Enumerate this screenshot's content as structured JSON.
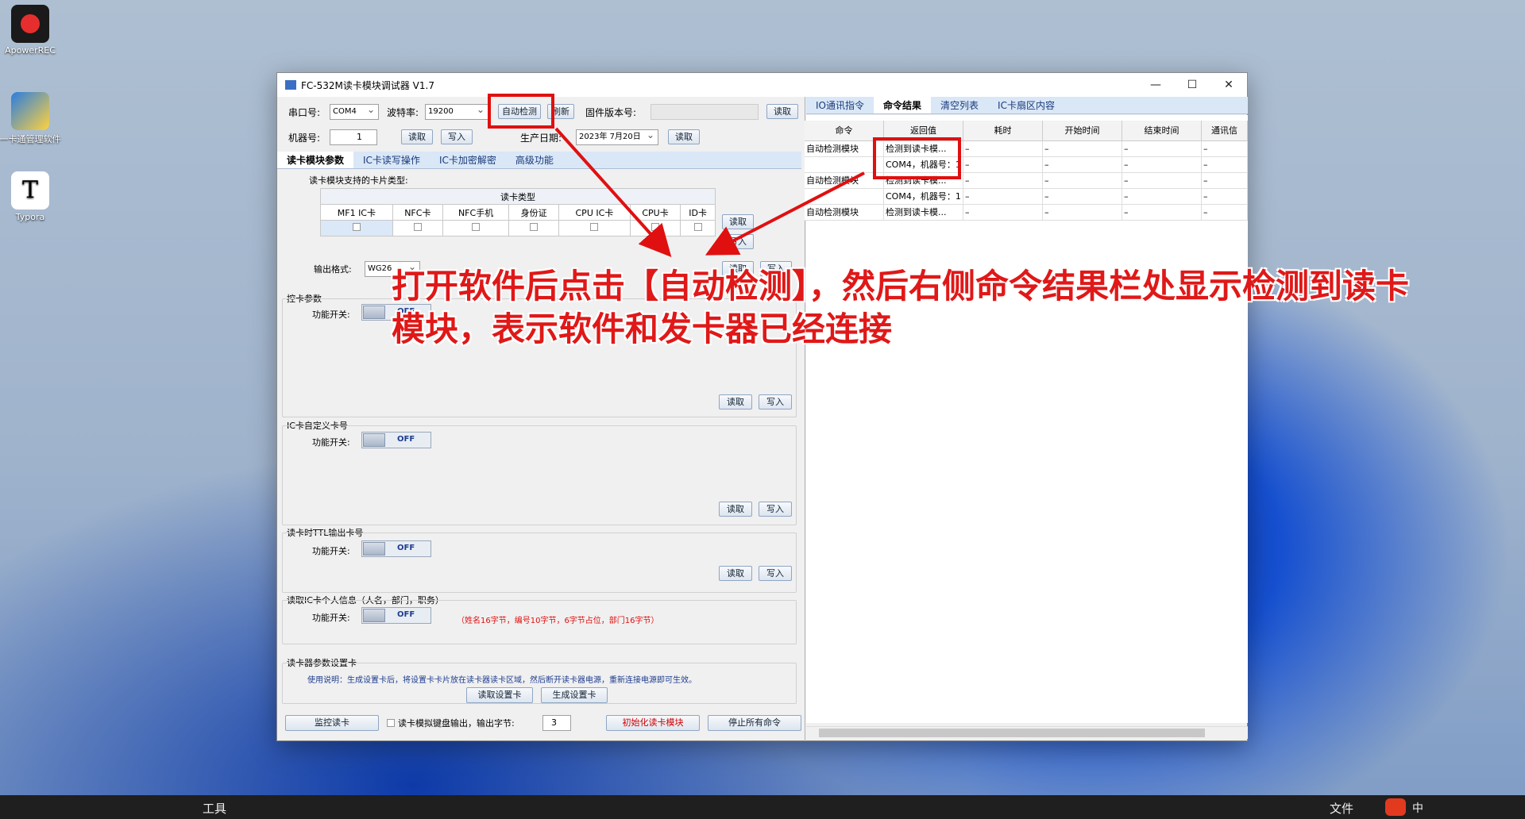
{
  "desktop": {
    "icons": [
      {
        "label": "ApowerREC"
      },
      {
        "label": "一卡通管理软件"
      },
      {
        "label": "Typora"
      }
    ]
  },
  "window": {
    "title": "FC-532M读卡模块调试器 V1.7",
    "min": "—",
    "max": "☐",
    "close": "✕"
  },
  "top": {
    "port_label": "串口号:",
    "port_value": "COM4",
    "baud_label": "波特率:",
    "baud_value": "19200",
    "auto_detect": "自动检测",
    "refresh": "刷新",
    "fw_label": "固件版本号:",
    "fw_read": "读取",
    "machine_label": "机器号:",
    "machine_value": "1",
    "read": "读取",
    "write": "写入",
    "date_label": "生产日期:",
    "date_value": "2023年 7月20日",
    "date_read": "读取"
  },
  "left_tabs": [
    "读卡模块参数",
    "IC卡读写操作",
    "IC卡加密解密",
    "高级功能"
  ],
  "card_types": {
    "title": "读卡模块支持的卡片类型:",
    "header": "读卡类型",
    "cols": [
      "MF1 IC卡",
      "NFC卡",
      "NFC手机",
      "身份证",
      "CPU IC卡",
      "CPU卡",
      "ID卡"
    ],
    "read": "读取",
    "write": "写入"
  },
  "output": {
    "label": "输出格式:",
    "value": "WG26",
    "read": "读取",
    "write": "写入"
  },
  "sections": [
    {
      "title": "控卡参数",
      "switch_label": "功能开关:",
      "state": "OFF",
      "read": "读取",
      "write": "写入"
    },
    {
      "title": "IC卡自定义卡号",
      "switch_label": "功能开关:",
      "state": "OFF",
      "read": "读取",
      "write": "写入"
    },
    {
      "title": "读卡时TTL输出卡号",
      "switch_label": "功能开关:",
      "state": "OFF",
      "read": "读取",
      "write": "写入"
    },
    {
      "title": "读取IC卡个人信息（人名，部门，职务）",
      "switch_label": "功能开关:",
      "state": "OFF",
      "note": "（姓名16字节，编号10字节，6字节占位，部门16字节）"
    }
  ],
  "param_card": {
    "title": "读卡器参数设置卡",
    "desc": "使用说明：生成设置卡后，将设置卡卡片放在读卡器读卡区域，然后断开读卡器电源，重新连接电源即可生效。",
    "read_btn": "读取设置卡",
    "gen_btn": "生成设置卡"
  },
  "bottom": {
    "monitor": "监控读卡",
    "kbd_label": "读卡模拟键盘输出，输出字节:",
    "kbd_value": "3",
    "init": "初始化读卡模块",
    "stop": "停止所有命令"
  },
  "right_tabs": [
    "IO通讯指令",
    "命令结果",
    "清空列表",
    "IC卡扇区内容"
  ],
  "cmd_table": {
    "headers": [
      "命令",
      "返回值",
      "耗时",
      "开始时间",
      "结束时间",
      "通讯信"
    ],
    "rows": [
      [
        "自动检测模块",
        "检测到读卡模...",
        "–",
        "–",
        "–",
        "–"
      ],
      [
        "",
        "COM4，机器号：1",
        "–",
        "–",
        "–",
        "–"
      ],
      [
        "自动检测模块",
        "检测到读卡模...",
        "–",
        "–",
        "–",
        "–"
      ],
      [
        "",
        "COM4，机器号：1",
        "–",
        "–",
        "–",
        "–"
      ],
      [
        "自动检测模块",
        "检测到读卡模...",
        "–",
        "–",
        "–",
        "–"
      ]
    ]
  },
  "annotation": {
    "line1": "打开软件后点击【自动检测】，然后右侧命令结果栏处显示检测到读卡",
    "line2": "模块，表示软件和发卡器已经连接"
  },
  "taskbar": {
    "left": "工具",
    "right": "文件",
    "ime": "中"
  },
  "colors": {
    "accent": "#e01010"
  }
}
